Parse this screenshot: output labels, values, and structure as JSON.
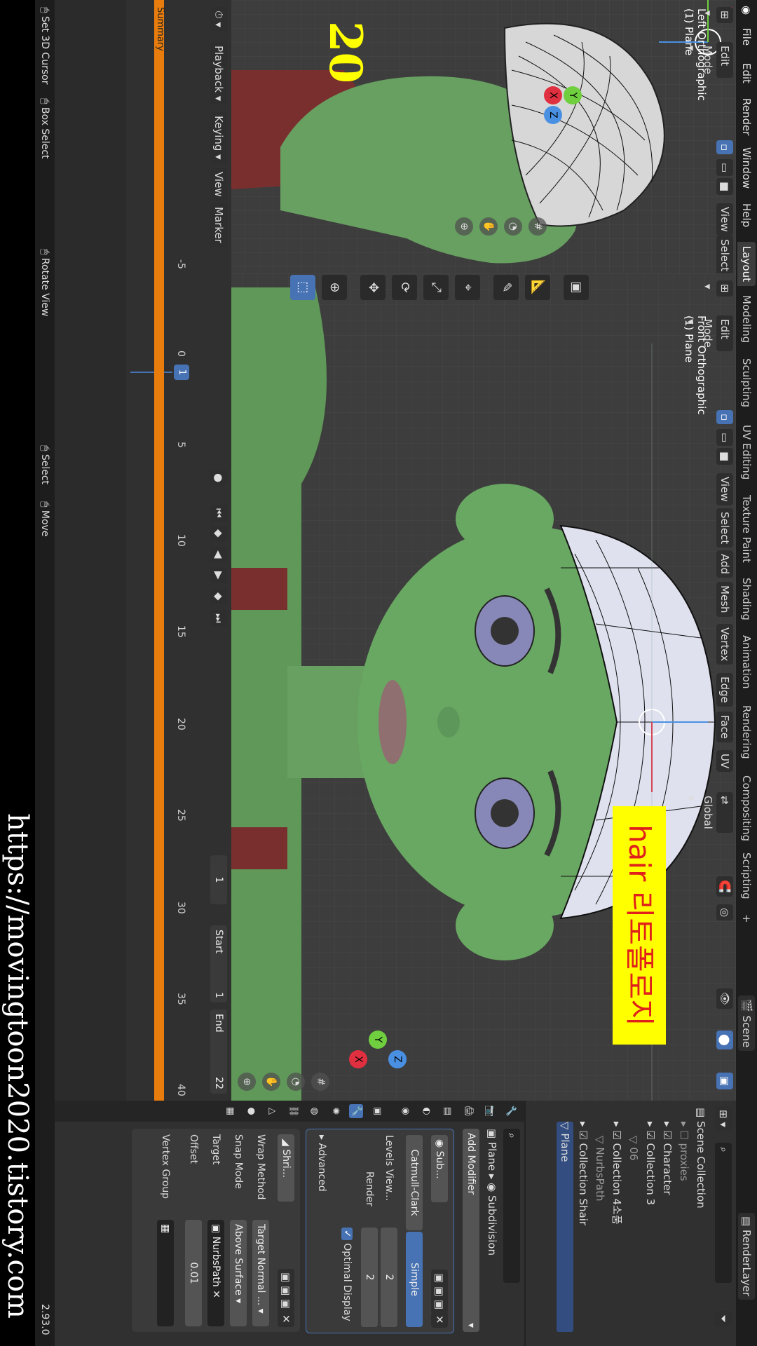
{
  "topbar": {
    "menus": [
      "File",
      "Edit",
      "Render",
      "Window",
      "Help"
    ],
    "workspaces": [
      "Layout",
      "Modeling",
      "Sculpting",
      "UV Editing",
      "Texture Paint",
      "Shading",
      "Animation",
      "Rendering",
      "Compositing",
      "Scripting"
    ],
    "add_tab": "+",
    "scene_label": "Scene",
    "view_layer_label": "RenderLayer"
  },
  "left_viewport": {
    "mode": "Edit Mode",
    "view_menu": "View",
    "select_menu": "Select",
    "label_line1": "Left Orthographic",
    "label_line2": "(1) Plane",
    "overlay_number": "20"
  },
  "main_viewport": {
    "mode": "Edit Mode",
    "menus": [
      "View",
      "Select",
      "Add",
      "Mesh",
      "Vertex",
      "Edge",
      "Face",
      "UV"
    ],
    "transform_orientation": "Global",
    "label_line1": "Front Orthographic",
    "label_line2": "(1) Plane",
    "annotation_text": "hair 리토폴로지",
    "annotation_bg": "#ffff00",
    "annotation_fg": "#e0201a"
  },
  "timeline": {
    "menus": [
      "Playback",
      "Keying",
      "View",
      "Marker"
    ],
    "ticks": [
      "-5",
      "0",
      "5",
      "10",
      "15",
      "20",
      "25",
      "30",
      "35",
      "40"
    ],
    "current_frame": "1",
    "frame_field": "1",
    "start_label": "Start",
    "start_value": "1",
    "end_label": "End",
    "end_value": "22",
    "summary_label": "Summary",
    "accent": "#e87d0d"
  },
  "status": {
    "items": [
      "Set 3D Cursor",
      "Box Select",
      "Rotate View",
      "Select",
      "Move"
    ],
    "version": "2.93.0"
  },
  "outliner": {
    "rows": [
      {
        "label": "Scene Collection"
      },
      {
        "label": "proxies"
      },
      {
        "label": "Character"
      },
      {
        "label": "Collection 3"
      },
      {
        "label": "06"
      },
      {
        "label": "Collection 4소품"
      },
      {
        "label": "NurbsPath"
      },
      {
        "label": "Collection Shair"
      },
      {
        "label": "Plane"
      }
    ]
  },
  "properties": {
    "object_name": "Plane",
    "modifier_breadcrumb": "Subdivision",
    "add_modifier": "Add Modifier",
    "subdiv": {
      "name": "Sub...",
      "method_a": "Catmull-Clark",
      "method_b": "Simple",
      "levels_viewport_label": "Levels View...",
      "levels_viewport_value": "2",
      "render_label": "Render",
      "render_value": "2",
      "optimal_display_label": "Optimal Display",
      "advanced_label": "Advanced"
    },
    "shrinkwrap": {
      "name": "Shri...",
      "wrap_method_label": "Wrap Method",
      "wrap_method_value": "Target Normal ...",
      "snap_mode_label": "Snap Mode",
      "snap_mode_value": "Above Surface",
      "target_label": "Target",
      "target_value": "NurbsPath",
      "offset_label": "Offset",
      "offset_value": "0.01",
      "vertex_group_label": "Vertex Group"
    }
  },
  "url_watermark": "https://movingtoon2020.tistory.com"
}
